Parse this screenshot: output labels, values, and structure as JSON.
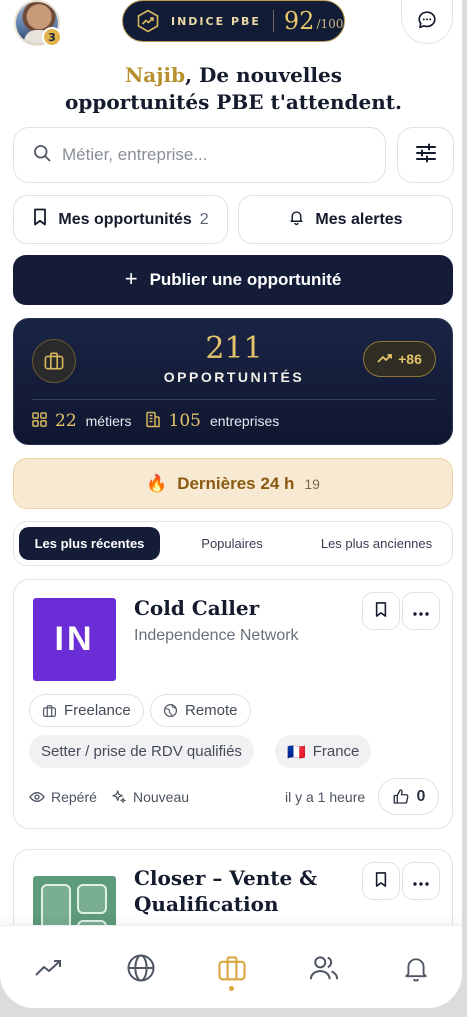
{
  "header": {
    "avatar_badge": "3",
    "index_label": "INDICE PBE",
    "index_score": "92",
    "index_max": "/100"
  },
  "greeting": {
    "name": "Najib",
    "line1_rest": ", De nouvelles",
    "line2": "opportunités PBE t'attendent."
  },
  "search": {
    "placeholder": "Métier, entreprise..."
  },
  "quick_actions": {
    "my_opportunities_label": "Mes opportunités",
    "my_opportunities_count": "2",
    "my_alerts_label": "Mes alertes"
  },
  "publish_button": {
    "label": "Publier une opportunité"
  },
  "stats": {
    "total": "211",
    "total_caption": "OPPORTUNITÉS",
    "trend": "+86",
    "jobs_count": "22",
    "jobs_label": "métiers",
    "companies_count": "105",
    "companies_label": "entreprises"
  },
  "latest": {
    "label": "Dernières 24 h",
    "count": "19"
  },
  "sort_tabs": [
    {
      "label": "Les plus récentes",
      "active": true
    },
    {
      "label": "Populaires",
      "active": false
    },
    {
      "label": "Les plus anciennes",
      "active": false
    }
  ],
  "opportunities": [
    {
      "logo_text": "IN",
      "title": "Cold Caller",
      "company": "Independence Network",
      "tags": [
        "Freelance",
        "Remote"
      ],
      "category": "Setter / prise de RDV qualifiés",
      "country_flag": "🇫🇷",
      "country": "France",
      "spotted_label": "Repéré",
      "new_label": "Nouveau",
      "posted": "il y a 1 heure",
      "likes": "0"
    },
    {
      "title_line1": "Closer – Vente &",
      "title_line2": "Qualification"
    }
  ],
  "colors": {
    "navy": "#141c38",
    "gold": "#e3c36c",
    "brand_in": "#6b2ed6",
    "latest_bg": "#f8ead2"
  },
  "icons": {
    "nav": [
      "trending-icon",
      "globe-icon",
      "briefcase-icon",
      "users-icon",
      "bell-icon"
    ],
    "active_nav": "briefcase-icon"
  }
}
